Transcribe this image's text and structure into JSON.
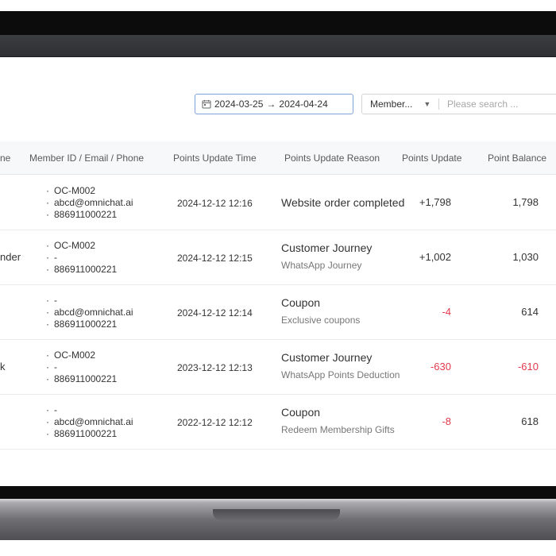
{
  "filters": {
    "date_start": "2024-03-25",
    "date_arrow": "→",
    "date_end": "2024-04-24",
    "search_type": "Member...",
    "search_placeholder": "Please search ..."
  },
  "table": {
    "columns": {
      "name_fragment": "ne",
      "member_ids": "Member ID / Email / Phone",
      "update_time": "Points Update Time",
      "update_reason": "Points Update Reason",
      "points_update": "Points Update",
      "point_balance": "Point Balance"
    },
    "rows": [
      {
        "name": "",
        "ids": [
          "OC-M002",
          "abcd@omnichat.ai",
          "886911000221"
        ],
        "time": "2024-12-12 12:16",
        "reason": "Website order completed",
        "reason_sub": "",
        "update": "+1,798",
        "balance": "1,798",
        "update_negative": false,
        "balance_negative": false
      },
      {
        "name": "nder",
        "ids": [
          "OC-M002",
          "-",
          "886911000221"
        ],
        "time": "2024-12-12 12:15",
        "reason": "Customer Journey",
        "reason_sub": "WhatsApp Journey",
        "update": "+1,002",
        "balance": "1,030",
        "update_negative": false,
        "balance_negative": false
      },
      {
        "name": "",
        "ids": [
          "-",
          "abcd@omnichat.ai",
          "886911000221"
        ],
        "time": "2024-12-12 12:14",
        "reason": "Coupon",
        "reason_sub": "Exclusive coupons",
        "update": "-4",
        "balance": "614",
        "update_negative": true,
        "balance_negative": false
      },
      {
        "name": "k",
        "ids": [
          "OC-M002",
          "-",
          "886911000221"
        ],
        "time": "2023-12-12 12:13",
        "reason": "Customer Journey",
        "reason_sub": "WhatsApp Points Deduction",
        "update": "-630",
        "balance": "-610",
        "update_negative": true,
        "balance_negative": true
      },
      {
        "name": "",
        "ids": [
          "-",
          "abcd@omnichat.ai",
          "886911000221"
        ],
        "time": "2022-12-12 12:12",
        "reason": "Coupon",
        "reason_sub": "Redeem Membership Gifts",
        "update": "-8",
        "balance": "618",
        "update_negative": true,
        "balance_negative": false
      }
    ]
  },
  "colors": {
    "negative": "#e23a4b",
    "accent_border": "#7fa3d8",
    "header_bg": "#f7f8fa"
  },
  "icons": {
    "date_picker": "calendar-icon",
    "select_caret": "caret-down-icon"
  }
}
